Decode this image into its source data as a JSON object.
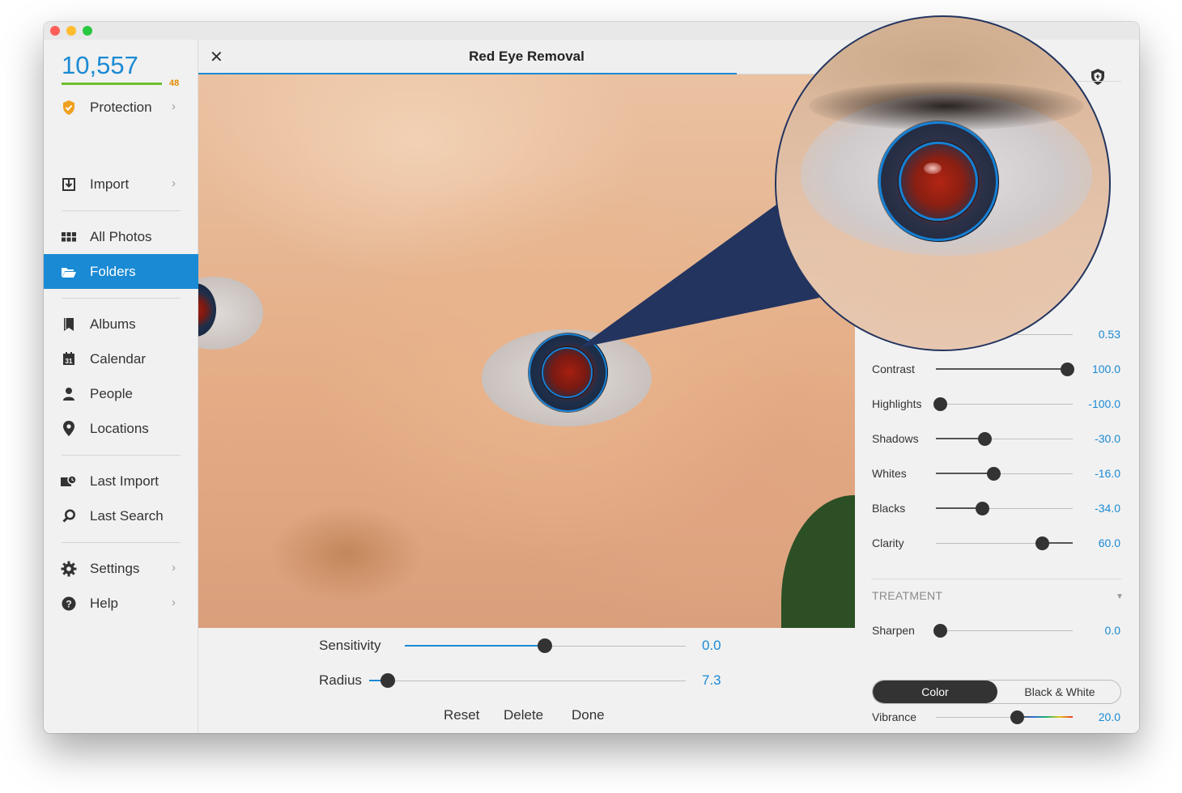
{
  "window": {
    "title": "Red Eye Removal"
  },
  "sidebar": {
    "photo_count": "10,557",
    "count_badge": "48",
    "protection_label": "Protection",
    "items": [
      {
        "label": "Import",
        "icon": "import-icon"
      },
      {
        "label": "All Photos",
        "icon": "grid-icon"
      },
      {
        "label": "Folders",
        "icon": "folder-icon",
        "active": true
      },
      {
        "label": "Albums",
        "icon": "album-icon"
      },
      {
        "label": "Calendar",
        "icon": "calendar-icon"
      },
      {
        "label": "People",
        "icon": "person-icon"
      },
      {
        "label": "Locations",
        "icon": "location-pin-icon"
      },
      {
        "label": "Last Import",
        "icon": "last-import-icon"
      },
      {
        "label": "Last Search",
        "icon": "search-icon"
      },
      {
        "label": "Settings",
        "icon": "gear-icon"
      },
      {
        "label": "Help",
        "icon": "help-icon"
      }
    ]
  },
  "tool": {
    "sensitivity_label": "Sensitivity",
    "sensitivity_value": "0.0",
    "radius_label": "Radius",
    "radius_value": "7.3",
    "actions": {
      "reset": "Reset",
      "delete": "Delete",
      "done": "Done"
    }
  },
  "adjustments": {
    "partial_value": "0.53",
    "sliders": [
      {
        "label": "Contrast",
        "value": "100.0"
      },
      {
        "label": "Highlights",
        "value": "-100.0"
      },
      {
        "label": "Shadows",
        "value": "-30.0"
      },
      {
        "label": "Whites",
        "value": "-16.0"
      },
      {
        "label": "Blacks",
        "value": "-34.0"
      },
      {
        "label": "Clarity",
        "value": "60.0"
      }
    ],
    "treatment_title": "TREATMENT",
    "sharpen_label": "Sharpen",
    "sharpen_value": "0.0",
    "segment": {
      "color": "Color",
      "bw": "Black & White"
    },
    "vibrance_label": "Vibrance",
    "vibrance_value": "20.0"
  },
  "colors": {
    "accent": "#1a8ad4",
    "callout": "#23345f",
    "count_bar": "#6cbf2d",
    "badge": "#e08a00"
  }
}
